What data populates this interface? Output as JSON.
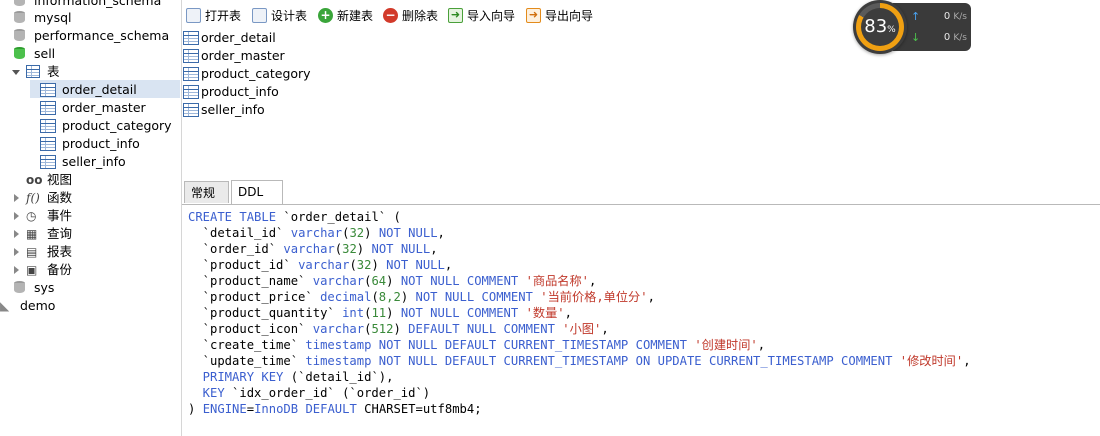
{
  "tree": {
    "databases": [
      {
        "name": "information_schema"
      },
      {
        "name": "mysql"
      },
      {
        "name": "performance_schema"
      },
      {
        "name": "sell"
      }
    ],
    "tables_folder": "表",
    "tables": [
      "order_detail",
      "order_master",
      "product_category",
      "product_info",
      "seller_info"
    ],
    "selected_table": "order_detail",
    "folders": [
      "视图",
      "函数",
      "事件",
      "查询",
      "报表",
      "备份"
    ],
    "more_databases": [
      "sys"
    ],
    "connection": "demo"
  },
  "toolbar": {
    "open_table": "打开表",
    "design_table": "设计表",
    "new_table": "新建表",
    "delete_table": "删除表",
    "import_wizard": "导入向导",
    "export_wizard": "导出向导"
  },
  "table_list": [
    "order_detail",
    "order_master",
    "product_category",
    "product_info",
    "seller_info"
  ],
  "tabs": {
    "general": "常规",
    "ddl": "DDL",
    "active": "DDL"
  },
  "ddl": {
    "create_kw": "CREATE TABLE",
    "table_name": "`order_detail` (",
    "columns": [
      {
        "name": "  `detail_id` ",
        "type": "varchar",
        "size": "32",
        "rest": [
          {
            "k": "NOT NULL"
          }
        ],
        "comment": "",
        "end": ","
      },
      {
        "name": "  `order_id` ",
        "type": "varchar",
        "size": "32",
        "rest": [
          {
            "k": "NOT NULL"
          }
        ],
        "comment": "",
        "end": ","
      },
      {
        "name": "  `product_id` ",
        "type": "varchar",
        "size": "32",
        "rest": [
          {
            "k": "NOT NULL"
          }
        ],
        "comment": "",
        "end": ","
      },
      {
        "name": "  `product_name` ",
        "type": "varchar",
        "size": "64",
        "rest": [
          {
            "k": "NOT NULL COMMENT"
          }
        ],
        "comment": "'商品名称'",
        "end": ","
      },
      {
        "name": "  `product_price` ",
        "type": "decimal",
        "size": "8,2",
        "rest": [
          {
            "k": "NOT NULL COMMENT"
          }
        ],
        "comment": "'当前价格,单位分'",
        "end": ","
      },
      {
        "name": "  `product_quantity` ",
        "type": "int",
        "size": "11",
        "rest": [
          {
            "k": "NOT NULL COMMENT"
          }
        ],
        "comment": "'数量'",
        "end": ","
      },
      {
        "name": "  `product_icon` ",
        "type": "varchar",
        "size": "512",
        "rest": [
          {
            "k": "DEFAULT NULL COMMENT"
          }
        ],
        "comment": "'小图'",
        "end": ","
      },
      {
        "name": "  `create_time` ",
        "type": "timestamp",
        "size": "",
        "rest": [
          {
            "k": "NOT NULL DEFAULT CURRENT_TIMESTAMP COMMENT"
          }
        ],
        "comment": "'创建时间'",
        "end": ","
      },
      {
        "name": "  `update_time` ",
        "type": "timestamp",
        "size": "",
        "rest": [
          {
            "k": "NOT NULL DEFAULT CURRENT_TIMESTAMP ON UPDATE CURRENT_TIMESTAMP COMMENT"
          }
        ],
        "comment": "'修改时间'",
        "end": ","
      }
    ],
    "primary_key_kw": "  PRIMARY KEY",
    "primary_key_cols": " (`detail_id`),",
    "key_kw": "  KEY",
    "key_def": " `idx_order_id` (`order_id`)",
    "close": ") ",
    "engine_kw": "ENGINE",
    "engine_val": "InnoDB",
    "default_kw": "DEFAULT",
    "charset_rest": "CHARSET=utf8mb4;"
  },
  "widget": {
    "percent": "83",
    "percent_sign": "%",
    "upload": "0",
    "download": "0",
    "unit": "K/s"
  },
  "colors": {
    "accent_keyword": "#3b5fcf",
    "string": "#c0392b",
    "number": "#3a8a3a",
    "selection": "#d9e4f2",
    "gauge": "#f0a012"
  }
}
